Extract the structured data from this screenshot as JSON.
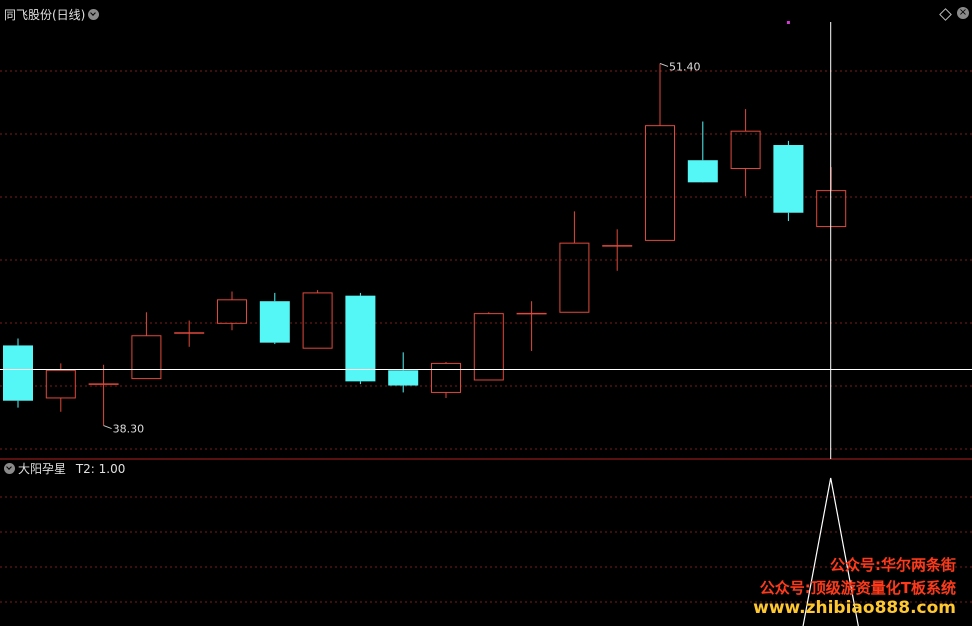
{
  "main_panel": {
    "title": "同飞股份(日线)",
    "high_label": "51.40",
    "low_label": "38.30"
  },
  "indicator_panel": {
    "title": "大阳孕星",
    "value_label": "T2: 1.00"
  },
  "watermark": {
    "line1": "公众号:华尔两条街",
    "line2": "公众号:顶级游资量化T板系统",
    "line3": "www.zhibiao888.com"
  },
  "colors": {
    "up": "#e0493a",
    "down": "#54f6f6",
    "grid": "#7a1c1c",
    "crosshair": "#ffffff",
    "marker": "#d23bd2",
    "indicator_line": "#ffffff"
  },
  "chart_data": [
    {
      "type": "candlestick",
      "title": "同飞股份(日线)",
      "ylim": [
        37.2,
        52.9
      ],
      "crosshair_index": 19,
      "candles": [
        {
          "o": 41.2,
          "h": 41.45,
          "l": 38.95,
          "c": 39.2
        },
        {
          "o": 39.3,
          "h": 40.55,
          "l": 38.8,
          "c": 40.3
        },
        {
          "o": 39.8,
          "h": 40.5,
          "l": 38.3,
          "c": 39.8
        },
        {
          "o": 40.0,
          "h": 42.4,
          "l": 40.0,
          "c": 41.55
        },
        {
          "o": 41.65,
          "h": 42.1,
          "l": 41.15,
          "c": 41.65
        },
        {
          "o": 42.0,
          "h": 43.15,
          "l": 41.75,
          "c": 42.85
        },
        {
          "o": 42.8,
          "h": 43.1,
          "l": 41.25,
          "c": 41.3
        },
        {
          "o": 41.1,
          "h": 43.2,
          "l": 41.1,
          "c": 43.1
        },
        {
          "o": 43.0,
          "h": 43.1,
          "l": 39.8,
          "c": 39.9
        },
        {
          "o": 40.3,
          "h": 40.95,
          "l": 39.5,
          "c": 39.75
        },
        {
          "o": 39.5,
          "h": 40.6,
          "l": 39.3,
          "c": 40.55
        },
        {
          "o": 39.95,
          "h": 42.4,
          "l": 39.95,
          "c": 42.35
        },
        {
          "o": 42.35,
          "h": 42.8,
          "l": 41.0,
          "c": 42.35
        },
        {
          "o": 42.4,
          "h": 46.05,
          "l": 42.4,
          "c": 44.9
        },
        {
          "o": 44.8,
          "h": 45.4,
          "l": 43.9,
          "c": 44.8
        },
        {
          "o": 45.0,
          "h": 51.4,
          "l": 45.0,
          "c": 49.15
        },
        {
          "o": 47.9,
          "h": 49.3,
          "l": 47.3,
          "c": 47.1
        },
        {
          "o": 47.6,
          "h": 49.75,
          "l": 46.6,
          "c": 48.95
        },
        {
          "o": 48.45,
          "h": 48.6,
          "l": 45.7,
          "c": 46.0
        },
        {
          "o": 45.5,
          "h": 47.65,
          "l": 45.5,
          "c": 46.8
        }
      ],
      "markers": [
        18,
        24
      ]
    },
    {
      "type": "line",
      "title": "大阳孕星",
      "series": [
        {
          "name": "T2",
          "values": [
            0,
            0,
            0,
            0,
            0,
            0,
            0,
            0,
            0,
            0,
            0,
            0,
            0,
            0,
            0,
            0,
            0,
            0,
            0,
            0,
            1,
            0,
            0,
            0,
            0,
            0,
            0,
            0,
            0,
            0,
            0
          ]
        }
      ],
      "ylim": [
        0,
        1
      ]
    }
  ]
}
